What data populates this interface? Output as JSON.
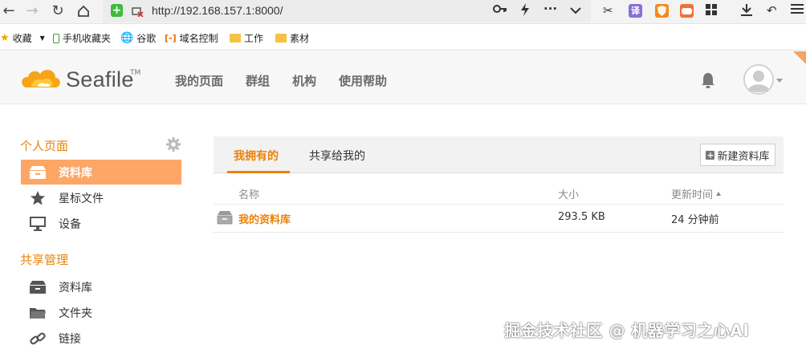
{
  "browser": {
    "url": "http://192.168.157.1:8000/",
    "extension_translate_label": "译"
  },
  "bookmarks": [
    {
      "label": "收藏"
    },
    {
      "label": "手机收藏夹"
    },
    {
      "label": "谷歌"
    },
    {
      "label": "域名控制"
    },
    {
      "label": "工作"
    },
    {
      "label": "素材"
    }
  ],
  "header": {
    "logo_text": "Seafile",
    "logo_tm": "TM",
    "nav": [
      "我的页面",
      "群组",
      "机构",
      "使用帮助"
    ]
  },
  "sidebar": {
    "personal_heading": "个人页面",
    "personal_items": [
      {
        "label": "资料库",
        "icon": "library-icon",
        "active": true
      },
      {
        "label": "星标文件",
        "icon": "star-icon",
        "active": false
      },
      {
        "label": "设备",
        "icon": "monitor-icon",
        "active": false
      }
    ],
    "share_heading": "共享管理",
    "share_items": [
      {
        "label": "资料库",
        "icon": "library-icon"
      },
      {
        "label": "文件夹",
        "icon": "folder-icon"
      },
      {
        "label": "链接",
        "icon": "link-icon"
      }
    ]
  },
  "main": {
    "tabs": [
      {
        "label": "我拥有的",
        "active": true
      },
      {
        "label": "共享给我的",
        "active": false
      }
    ],
    "new_library_button": "新建资料库",
    "columns": {
      "name": "名称",
      "size": "大小",
      "updated": "更新时间"
    },
    "rows": [
      {
        "name": "我的资料库",
        "size": "293.5 KB",
        "updated": "24 分钟前"
      }
    ]
  },
  "watermark": "掘金技术社区 @ 机器学习之心AI",
  "colors": {
    "accent": "#eb8205",
    "active_bg": "#fea666"
  }
}
